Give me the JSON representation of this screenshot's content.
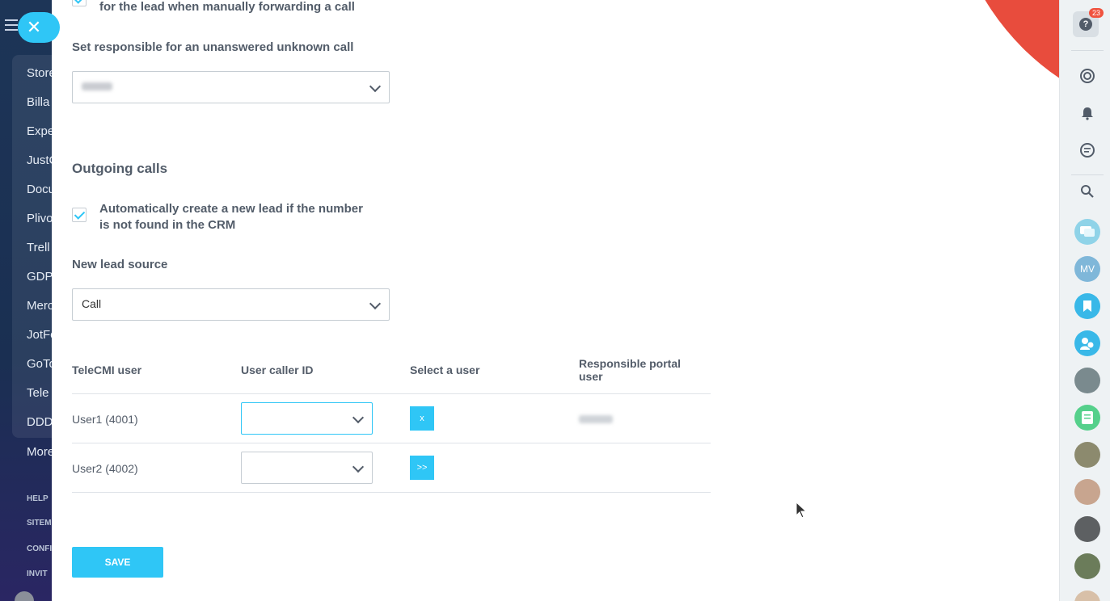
{
  "left_nav": {
    "items": [
      "Store",
      "Billa",
      "Expe",
      "JustC",
      "Docu",
      "Plivo",
      "Trell",
      "GDP",
      "Merc",
      "JotFo",
      "GoTo",
      "Tele",
      "DDD",
      "More"
    ],
    "footer_items": [
      "HELP",
      "SITEM",
      "CONFI",
      "INVIT"
    ]
  },
  "form": {
    "prev_checkbox_label": "for the lead when manually forwarding a call",
    "unanswered_label": "Set responsible for an unanswered unknown call",
    "outgoing_title": "Outgoing calls",
    "auto_create_label_line1": "Automatically create a new lead if the number",
    "auto_create_label_line2": "is not found in the CRM",
    "lead_source_label": "New lead source",
    "lead_source_value": "Call"
  },
  "table": {
    "headers": {
      "telecmi_user": "TeleCMI user",
      "caller_id": "User caller ID",
      "select_user": "Select a user",
      "responsible_line1": "Responsible portal",
      "responsible_line2": "user"
    },
    "rows": [
      {
        "user": "User1 (4001)",
        "button": "x"
      },
      {
        "user": "User2 (4002)",
        "button": ">>"
      }
    ]
  },
  "save_label": "SAVE",
  "right_bar": {
    "help_badge": "23",
    "mv_initials": "MV"
  },
  "colors": {
    "accent": "#2fc6f6",
    "red_decor": "#e84c3d"
  }
}
